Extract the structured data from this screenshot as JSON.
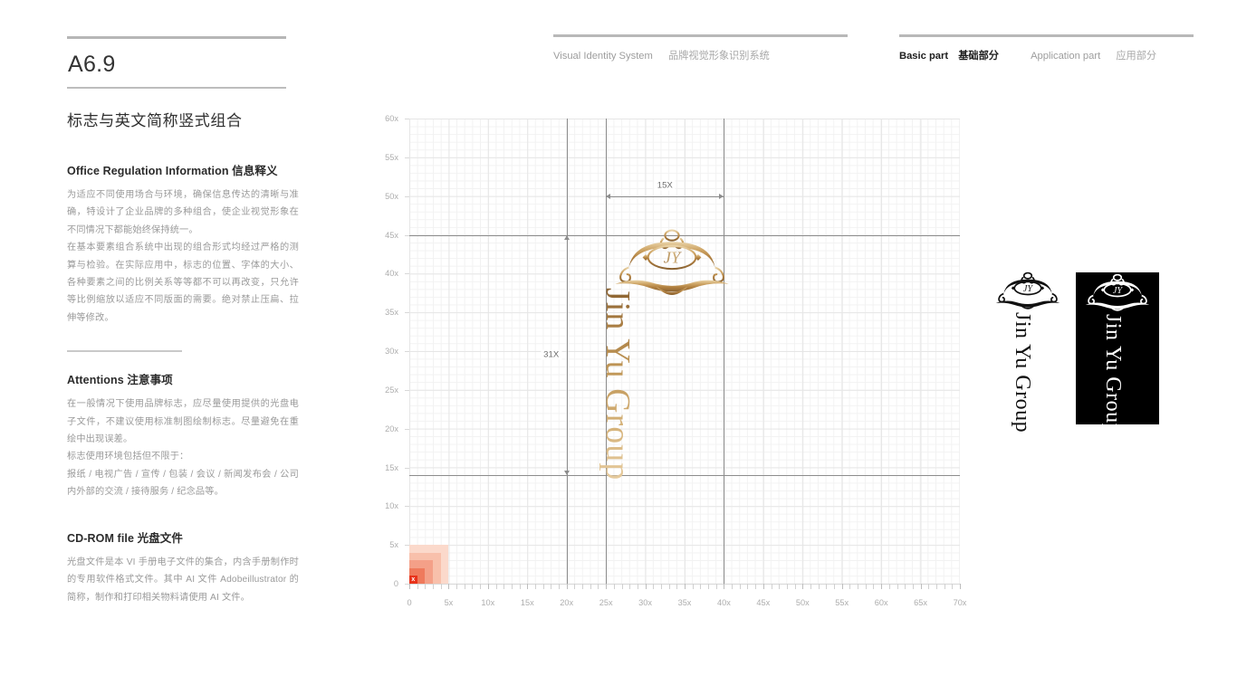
{
  "page": {
    "code": "A6.9",
    "section_title": "标志与英文简称竖式组合"
  },
  "header": {
    "left": {
      "en": "Visual Identity System",
      "cn": "品牌视觉形象识别系统"
    },
    "right": {
      "basic_en": "Basic part",
      "basic_cn": "基础部分",
      "application_en": "Application part",
      "application_cn": "应用部分"
    }
  },
  "blocks": [
    {
      "head_en": "Office Regulation Information ",
      "head_cn": "信息释义",
      "paragraphs": [
        "为适应不同使用场合与环境，确保信息传达的清晰与准确，特设计了企业品牌的多种组合，使企业视觉形象在不同情况下都能始终保持统一。",
        "在基本要素组合系统中出现的组合形式均经过严格的测算与检验。在实际应用中，标志的位置、字体的大小、各种要素之间的比例关系等等都不可以再改变，只允许等比例缩放以适应不同版面的需要。绝对禁止压扁、拉伸等修改。"
      ]
    },
    {
      "head_en": "Attentions ",
      "head_cn": "注意事项",
      "paragraphs": [
        "在一般情况下使用品牌标志，应尽量使用提供的光盘电子文件，不建议使用标准制图绘制标志。尽量避免在重绘中出现误差。",
        "标志使用环境包括但不限于：",
        "报纸 / 电视广告 / 宣传 / 包装 / 会议 / 新闻发布会 / 公司内外部的交流 / 接待服务 / 纪念品等。"
      ]
    },
    {
      "head_en": "CD-ROM file ",
      "head_cn": "光盘文件",
      "paragraphs": [
        "光盘文件是本 VI 手册电子文件的集合，内含手册制作时的专用软件格式文件。其中 AI 文件 Adobeillustrator 的简称，制作和打印相关物料请使用 AI 文件。"
      ]
    }
  ],
  "logo": {
    "monogram": "JY",
    "wordmark": "Jin Yu Group",
    "gold_dark": "#8a6231",
    "gold_light": "#e6cb9e"
  },
  "chart_data": {
    "type": "scatter",
    "title": "",
    "xlabel": "",
    "ylabel": "",
    "xlim": [
      0,
      70
    ],
    "ylim": [
      0,
      60
    ],
    "grid": true,
    "x_major_step": 5,
    "y_major_step": 5,
    "x_minor_step": 1,
    "y_minor_step": 1,
    "x_ticks": [
      "0",
      "5x",
      "10x",
      "15x",
      "20x",
      "25x",
      "30x",
      "35x",
      "40x",
      "45x",
      "50x",
      "55x",
      "60x",
      "65x",
      "70x"
    ],
    "y_ticks": [
      "0",
      "5x",
      "10x",
      "15x",
      "20x",
      "25x",
      "30x",
      "35x",
      "40x",
      "45x",
      "50x",
      "55x",
      "60x"
    ],
    "guides_horizontal": [
      45,
      14
    ],
    "guides_vertical": [
      20,
      25,
      40
    ],
    "annotations": [
      {
        "label": "15X",
        "orientation": "horizontal",
        "from": 25,
        "to": 40,
        "at": 50
      },
      {
        "label": "31X",
        "orientation": "vertical",
        "from": 14,
        "to": 45,
        "at": 20
      }
    ],
    "heatmap_origin": {
      "marker": "x",
      "cells": [
        {
          "x0": 0,
          "y0": 0,
          "x1": 5,
          "y1": 5,
          "color": "#fbd9cb"
        },
        {
          "x0": 0,
          "y0": 0,
          "x1": 4,
          "y1": 4,
          "color": "#f8c0ab"
        },
        {
          "x0": 0,
          "y0": 0,
          "x1": 3,
          "y1": 3,
          "color": "#f4a088"
        },
        {
          "x0": 0,
          "y0": 0,
          "x1": 2,
          "y1": 2,
          "color": "#ef7a5c"
        },
        {
          "x0": 0,
          "y0": 0,
          "x1": 1,
          "y1": 1,
          "color": "#e8331b"
        }
      ]
    }
  },
  "variants": [
    {
      "name": "monochrome-black",
      "fg": "#111111",
      "bg": "#ffffff"
    },
    {
      "name": "reversed-white",
      "fg": "#ffffff",
      "bg": "#000000"
    }
  ]
}
